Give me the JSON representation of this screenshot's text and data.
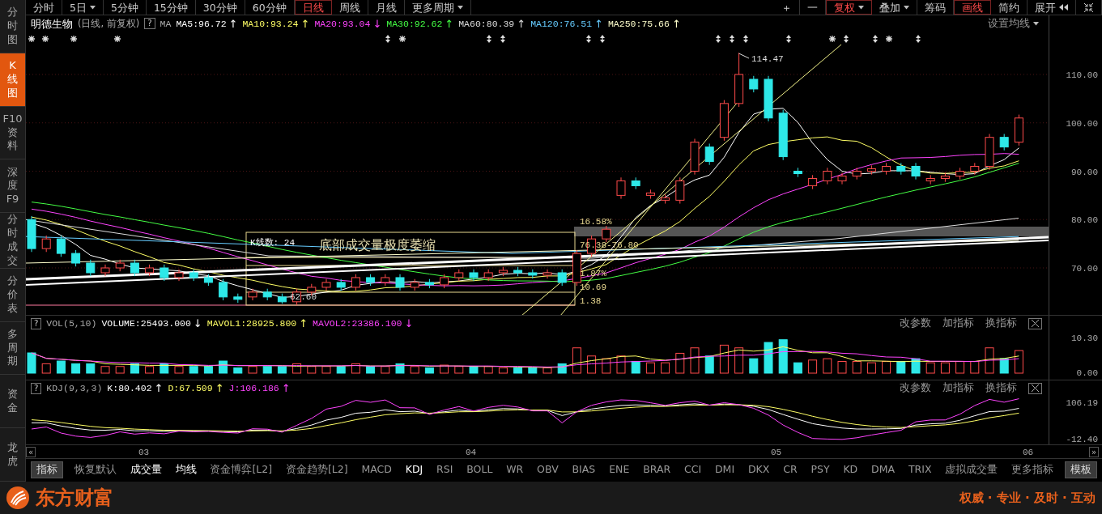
{
  "sidebar": {
    "items": [
      {
        "label": "分时图",
        "selected": false
      },
      {
        "label": "K线图",
        "selected": true
      },
      {
        "label": "F10资料",
        "selected": false
      },
      {
        "label": "深度F9",
        "selected": false
      },
      {
        "label": "分时成交",
        "selected": false
      },
      {
        "label": "分价表",
        "selected": false
      },
      {
        "label": "多周期",
        "selected": false
      },
      {
        "label": "资金",
        "selected": false
      },
      {
        "label": "龙虎",
        "selected": false
      }
    ]
  },
  "toolbar": {
    "periods": [
      {
        "label": "分时",
        "selected": false,
        "dropdown": false
      },
      {
        "label": "5日",
        "selected": false,
        "dropdown": true
      },
      {
        "label": "5分钟",
        "selected": false,
        "dropdown": false
      },
      {
        "label": "15分钟",
        "selected": false,
        "dropdown": false
      },
      {
        "label": "30分钟",
        "selected": false,
        "dropdown": false
      },
      {
        "label": "60分钟",
        "selected": false,
        "dropdown": false
      },
      {
        "label": "日线",
        "selected": true,
        "dropdown": false
      },
      {
        "label": "周线",
        "selected": false,
        "dropdown": false
      },
      {
        "label": "月线",
        "selected": false,
        "dropdown": false
      },
      {
        "label": "更多周期",
        "selected": false,
        "dropdown": true
      }
    ],
    "tools": [
      {
        "kind": "text",
        "label": "＋",
        "selected": false,
        "dropdown": false
      },
      {
        "kind": "text",
        "label": "一",
        "selected": false,
        "dropdown": false
      },
      {
        "kind": "text",
        "label": "复权",
        "selected": true,
        "dropdown": true
      },
      {
        "kind": "text",
        "label": "叠加",
        "selected": false,
        "dropdown": true
      },
      {
        "kind": "text",
        "label": "筹码",
        "selected": false,
        "dropdown": false
      },
      {
        "kind": "text",
        "label": "画线",
        "selected": true,
        "dropdown": false
      },
      {
        "kind": "text",
        "label": "简约",
        "selected": false,
        "dropdown": false
      },
      {
        "kind": "expand",
        "label": "展开",
        "selected": false
      },
      {
        "kind": "shrink",
        "selected": false
      }
    ]
  },
  "stock": {
    "name": "明德生物",
    "mode": "(日线, 前复权)",
    "help": "?",
    "ma_label": "MA",
    "ma": [
      {
        "label": "MA5:96.72",
        "arrow": "↑",
        "color": "#ffffff"
      },
      {
        "label": "MA10:93.24",
        "arrow": "↑",
        "color": "#ffff66"
      },
      {
        "label": "MA20:93.04",
        "arrow": "↓",
        "color": "#ff44ff"
      },
      {
        "label": "MA30:92.62",
        "arrow": "↑",
        "color": "#44ff44"
      },
      {
        "label": "MA60:80.39",
        "arrow": "↑",
        "color": "#dddddd"
      },
      {
        "label": "MA120:76.51",
        "arrow": "↑",
        "color": "#66ccff"
      },
      {
        "label": "MA250:75.66",
        "arrow": "↑",
        "color": "#ffffcc"
      }
    ],
    "settings": "设置均线"
  },
  "main_chart": {
    "y_labels": [
      "110.00",
      "100.00",
      "90.00",
      "80.00",
      "70.00"
    ],
    "high_label": "114.47",
    "low_label": "62.60",
    "count_label": "K线数: 24",
    "note": "底部成交量极度萎缩",
    "levels": [
      "16.58%",
      "76.38-76.80",
      "1.87%",
      "10.69",
      "1.38"
    ]
  },
  "volume_panel": {
    "help": "?",
    "title": "VOL(5,10)",
    "values": [
      {
        "label": "VOLUME:25493.000",
        "arrow": "↓",
        "color": "#ffffff"
      },
      {
        "label": "MAVOL1:28925.800",
        "arrow": "↑",
        "color": "#ffff66"
      },
      {
        "label": "MAVOL2:23386.100",
        "arrow": "↓",
        "color": "#ff44ff"
      }
    ],
    "actions": [
      "改参数",
      "加指标",
      "换指标"
    ],
    "y_labels": [
      "10.30",
      "0.00"
    ]
  },
  "kdj_panel": {
    "help": "?",
    "title": "KDJ(9,3,3)",
    "values": [
      {
        "label": "K:80.402",
        "arrow": "↑",
        "color": "#ffffff"
      },
      {
        "label": "D:67.509",
        "arrow": "↑",
        "color": "#ffff66"
      },
      {
        "label": "J:106.186",
        "arrow": "↑",
        "color": "#ff44ff"
      }
    ],
    "actions": [
      "改参数",
      "加指标",
      "换指标"
    ],
    "y_labels": [
      "106.19",
      "-12.40"
    ]
  },
  "x_axis": {
    "scroll_left": "«",
    "labels": [
      "03",
      "04",
      "05",
      "06"
    ],
    "scroll_right": "»"
  },
  "indicator_tabs": [
    {
      "label": "指标",
      "kind": "button"
    },
    {
      "label": "恢复默认",
      "kind": "tab",
      "selected": false
    },
    {
      "label": "成交量",
      "kind": "tab",
      "selected": true
    },
    {
      "label": "均线",
      "kind": "tab",
      "selected": true
    },
    {
      "label": "资金博弈[L2]",
      "kind": "tab",
      "selected": false
    },
    {
      "label": "资金趋势[L2]",
      "kind": "tab",
      "selected": false
    },
    {
      "label": "MACD",
      "kind": "tab",
      "selected": false
    },
    {
      "label": "KDJ",
      "kind": "tab",
      "selected": true
    },
    {
      "label": "RSI",
      "kind": "tab",
      "selected": false
    },
    {
      "label": "BOLL",
      "kind": "tab",
      "selected": false
    },
    {
      "label": "WR",
      "kind": "tab",
      "selected": false
    },
    {
      "label": "OBV",
      "kind": "tab",
      "selected": false
    },
    {
      "label": "BIAS",
      "kind": "tab",
      "selected": false
    },
    {
      "label": "ENE",
      "kind": "tab",
      "selected": false
    },
    {
      "label": "BRAR",
      "kind": "tab",
      "selected": false
    },
    {
      "label": "CCI",
      "kind": "tab",
      "selected": false
    },
    {
      "label": "DMI",
      "kind": "tab",
      "selected": false
    },
    {
      "label": "DKX",
      "kind": "tab",
      "selected": false
    },
    {
      "label": "CR",
      "kind": "tab",
      "selected": false
    },
    {
      "label": "PSY",
      "kind": "tab",
      "selected": false
    },
    {
      "label": "KD",
      "kind": "tab",
      "selected": false
    },
    {
      "label": "DMA",
      "kind": "tab",
      "selected": false
    },
    {
      "label": "TRIX",
      "kind": "tab",
      "selected": false
    },
    {
      "label": "虚拟成交量",
      "kind": "tab",
      "selected": false
    },
    {
      "label": "更多指标",
      "kind": "tab",
      "selected": false
    },
    {
      "label": "模板",
      "kind": "button"
    }
  ],
  "footer": {
    "brand": "东方财富",
    "slogan": "权威 · 专业 · 及时 · 互动"
  }
}
